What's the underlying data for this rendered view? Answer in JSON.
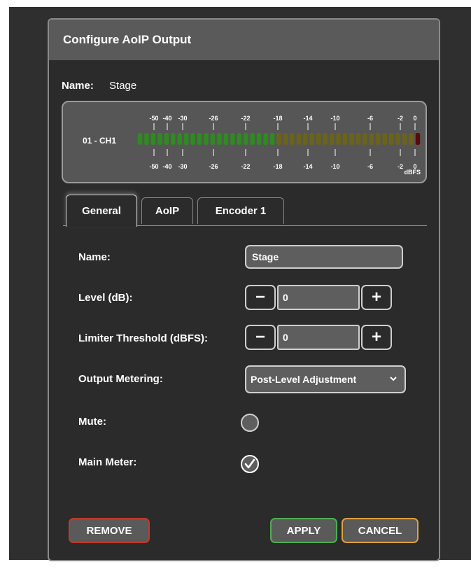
{
  "dialog": {
    "title": "Configure AoIP Output",
    "name_label": "Name:",
    "name_value": "Stage"
  },
  "meter": {
    "channel_label": "01 - CH1",
    "scale_labels": [
      "-50",
      "-40",
      "-30",
      "-26",
      "-22",
      "-18",
      "-14",
      "-10",
      "-6",
      "-2",
      "0"
    ],
    "unit_label": "dBFS",
    "colors": {
      "green": "#2e8b1f",
      "olive": "#6b6418",
      "red": "#5a0a0a"
    }
  },
  "tabs": [
    {
      "label": "General",
      "active": true
    },
    {
      "label": "AoIP",
      "active": false
    },
    {
      "label": "Encoder 1",
      "active": false
    }
  ],
  "form": {
    "name_label": "Name:",
    "name_value": "Stage",
    "level_label": "Level (dB):",
    "level_value": "0",
    "limiter_label": "Limiter Threshold (dBFS):",
    "limiter_value": "0",
    "metering_label": "Output Metering:",
    "metering_value": "Post-Level Adjustment",
    "mute_label": "Mute:",
    "mute_checked": false,
    "main_meter_label": "Main Meter:",
    "main_meter_checked": true,
    "minus_symbol": "−",
    "plus_symbol": "+"
  },
  "buttons": {
    "remove": "REMOVE",
    "apply": "APPLY",
    "cancel": "CANCEL"
  }
}
